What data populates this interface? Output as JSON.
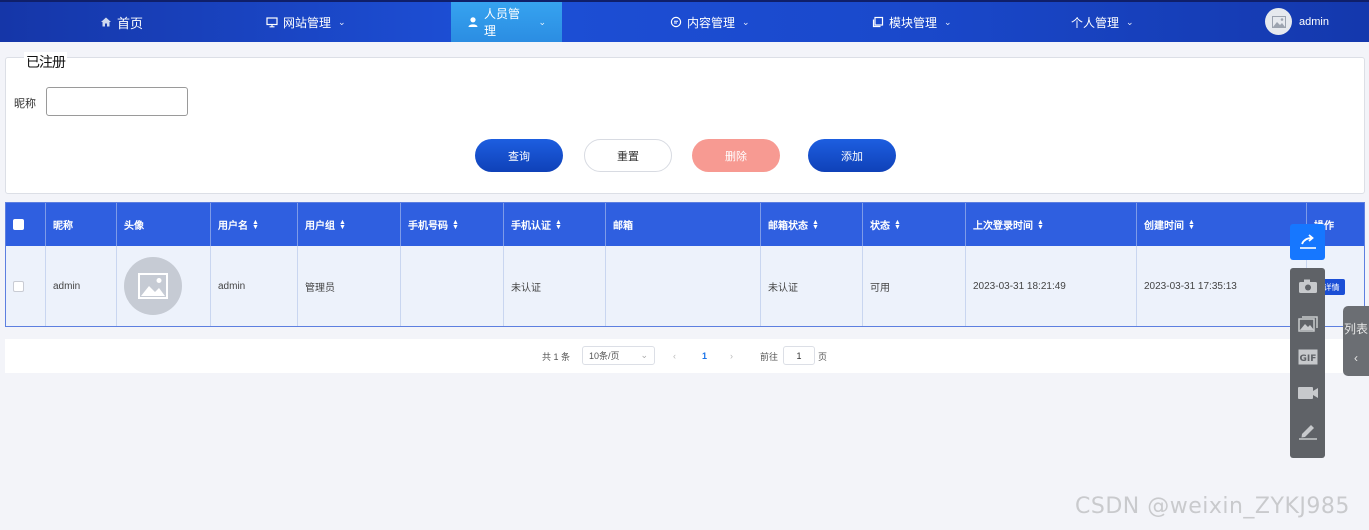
{
  "nav": {
    "items": [
      {
        "label": "首页",
        "icon": "home-icon"
      },
      {
        "label": "网站管理",
        "icon": "monitor-icon"
      },
      {
        "label": "人员管理",
        "icon": "user-icon"
      },
      {
        "label": "内容管理",
        "icon": "chat-icon"
      },
      {
        "label": "模块管理",
        "icon": "copy-icon"
      },
      {
        "label": "个人管理",
        "icon": ""
      }
    ],
    "active_index": 2,
    "user": "admin"
  },
  "search": {
    "legend": "已注册",
    "nickname_label": "昵称",
    "nickname_value": "",
    "buttons": {
      "query": "查询",
      "reset": "重置",
      "delete": "删除",
      "add": "添加"
    }
  },
  "table": {
    "headers": [
      "昵称",
      "头像",
      "用户名",
      "用户组",
      "手机号码",
      "手机认证",
      "邮箱",
      "邮箱状态",
      "状态",
      "上次登录时间",
      "创建时间",
      "操作"
    ],
    "rows": [
      {
        "nickname": "admin",
        "username": "admin",
        "group": "管理员",
        "phone": "",
        "phone_auth": "未认证",
        "email": "",
        "email_status": "未认证",
        "status": "可用",
        "last_login": "2023-03-31 18:21:49",
        "created": "2023-03-31 17:35:13",
        "action": "详情"
      }
    ]
  },
  "pagination": {
    "total": "共 1 条",
    "page_size": "10条/页",
    "current_page": "1",
    "goto_label": "前往",
    "goto_value": "1",
    "page_suffix": "页"
  },
  "overlay": {
    "side_tab": "列表",
    "watermark": "CSDN @weixin_ZYKJ985",
    "share_color": "#1677ff"
  }
}
